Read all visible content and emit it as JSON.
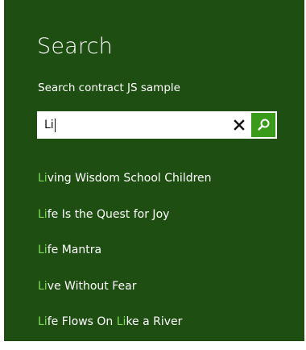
{
  "pane": {
    "title": "Search",
    "subtitle": "Search contract JS sample"
  },
  "search": {
    "query": "Li",
    "clear_icon": "close-icon",
    "go_icon": "search-icon"
  },
  "results": [
    {
      "parts": [
        {
          "text": "Li",
          "hl": true
        },
        {
          "text": "ving Wisdom School Children",
          "hl": false
        }
      ]
    },
    {
      "parts": [
        {
          "text": "Li",
          "hl": true
        },
        {
          "text": "fe Is the Quest for Joy",
          "hl": false
        }
      ]
    },
    {
      "parts": [
        {
          "text": "Li",
          "hl": true
        },
        {
          "text": "fe Mantra",
          "hl": false
        }
      ]
    },
    {
      "parts": [
        {
          "text": "Li",
          "hl": true
        },
        {
          "text": "ve Without Fear",
          "hl": false
        }
      ]
    },
    {
      "parts": [
        {
          "text": "Li",
          "hl": true
        },
        {
          "text": "fe Flows On ",
          "hl": false
        },
        {
          "text": "Li",
          "hl": true
        },
        {
          "text": "ke a River",
          "hl": false
        }
      ]
    }
  ],
  "colors": {
    "background": "#1e4e12",
    "highlight": "#7ed957",
    "go_button": "#3a9a1a"
  }
}
